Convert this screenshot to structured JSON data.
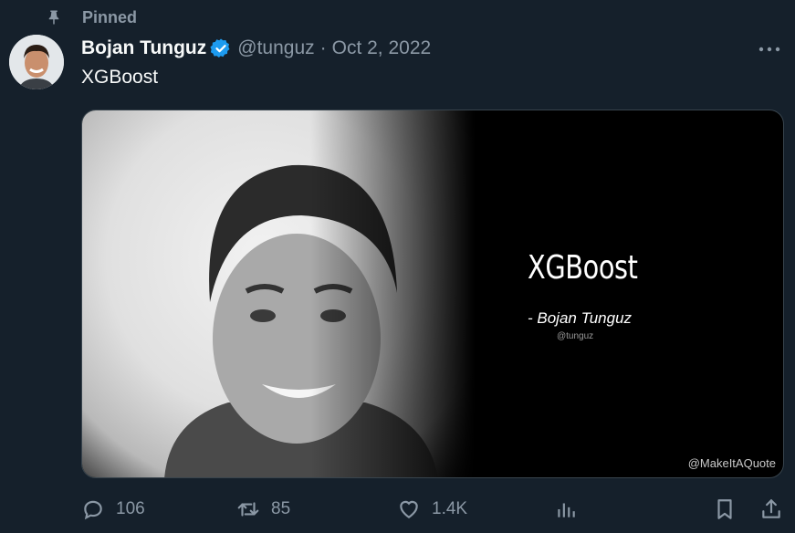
{
  "pinned": {
    "label": "Pinned",
    "icon": "pin-icon"
  },
  "author": {
    "display_name": "Bojan Tunguz",
    "verified": true,
    "handle": "@tunguz",
    "separator": "·",
    "date": "Oct 2, 2022"
  },
  "tweet": {
    "text": "XGBoost"
  },
  "media": {
    "quote": "XGBoost",
    "quote_author": "- Bojan Tunguz",
    "quote_handle": "@tunguz",
    "watermark": "@MakeItAQuote"
  },
  "actions": {
    "replies": "106",
    "retweets": "85",
    "likes": "1.4K"
  },
  "colors": {
    "background": "#15202b",
    "text": "#f7f9f9",
    "secondary_text": "#8b98a5",
    "verified_badge": "#1d9bf0"
  }
}
